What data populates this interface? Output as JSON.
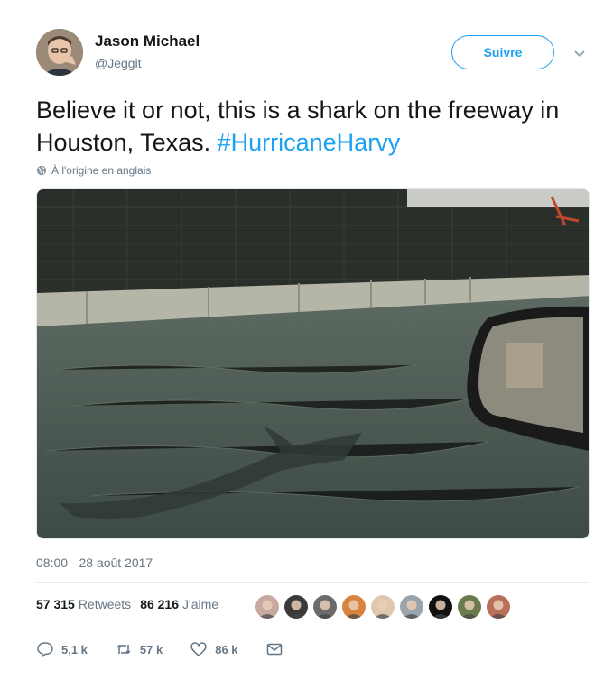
{
  "author": {
    "display_name": "Jason Michael",
    "handle": "@Jeggit"
  },
  "follow_button": "Suivre",
  "tweet": {
    "text_before": "Believe it or not, this is a shark on the freeway in Houston, Texas. ",
    "hashtag": "#HurricaneHarvy"
  },
  "translate_label": "À l'origine en anglais",
  "timestamp": "08:00 - 28 août 2017",
  "stats": {
    "retweets_count": "57 315",
    "retweets_label": "Retweets",
    "likes_count": "86 216",
    "likes_label": "J'aime"
  },
  "liker_avatars": [
    {
      "color": "#c7a9a0"
    },
    {
      "color": "#3a3a3a"
    },
    {
      "color": "#6b6b6b"
    },
    {
      "color": "#d9843e"
    },
    {
      "color": "#e0c8b0"
    },
    {
      "color": "#9aa4ad"
    },
    {
      "color": "#111111"
    },
    {
      "color": "#6b7a4a"
    },
    {
      "color": "#b8705a"
    }
  ],
  "actions": {
    "reply_count": "5,1 k",
    "retweet_count": "57 k",
    "like_count": "86 k"
  },
  "colors": {
    "accent": "#1da1f2",
    "secondary_text": "#657786"
  }
}
